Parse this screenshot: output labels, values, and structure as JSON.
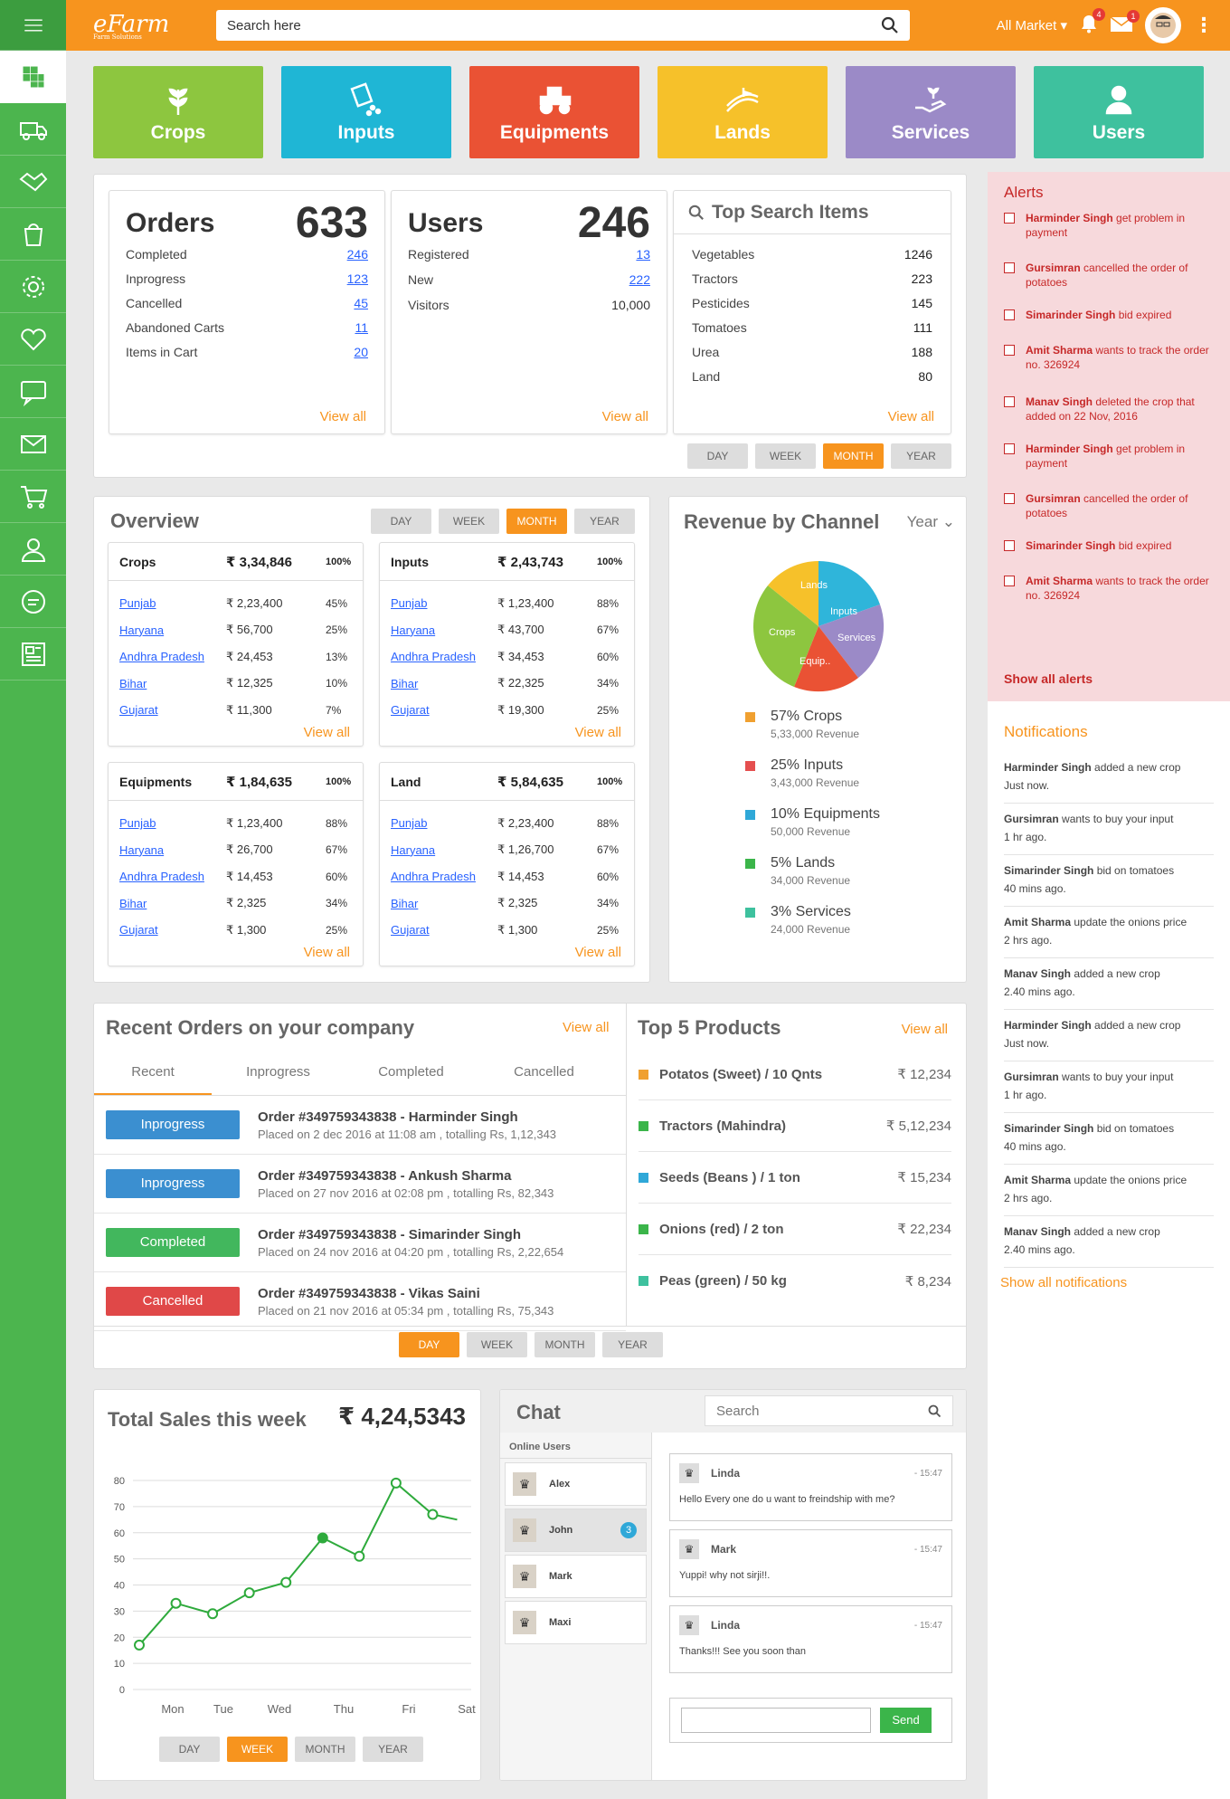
{
  "topbar": {
    "logo": "eFarm",
    "logo_sub": "Farm Solutions",
    "search_placeholder": "Search here",
    "market": "All Market",
    "notif_count": "4",
    "mail_count": "1"
  },
  "sidebar": {
    "items": [
      "dashboard-icon",
      "truck-icon",
      "handshake-icon",
      "shopping-bag-icon",
      "gear-icon",
      "heart-icon",
      "sms-icon",
      "mail-icon",
      "cart-icon",
      "user-icon",
      "chat-icon",
      "news-icon"
    ]
  },
  "tiles": [
    {
      "label": "Crops",
      "color": "#8dc63f",
      "icon": "crop-icon"
    },
    {
      "label": "Inputs",
      "color": "#1fb6d5",
      "icon": "inputs-icon"
    },
    {
      "label": "Equipments",
      "color": "#ea5234",
      "icon": "tractor-icon"
    },
    {
      "label": "Lands",
      "color": "#f6c12a",
      "icon": "land-icon"
    },
    {
      "label": "Services",
      "color": "#9b8ac7",
      "icon": "services-icon"
    },
    {
      "label": "Users",
      "color": "#3ec19e",
      "icon": "users-icon"
    }
  ],
  "orders": {
    "title": "Orders",
    "total": "633",
    "rows": [
      {
        "label": "Completed",
        "value": "246"
      },
      {
        "label": "Inprogress",
        "value": "123"
      },
      {
        "label": "Cancelled",
        "value": "45"
      },
      {
        "label": "Abandoned Carts",
        "value": "11"
      },
      {
        "label": "Items in Cart",
        "value": "20"
      }
    ],
    "view_all": "View all"
  },
  "users": {
    "title": "Users",
    "total": "246",
    "rows": [
      {
        "label": "Registered",
        "value": "13",
        "link": true
      },
      {
        "label": "New",
        "value": "222",
        "link": true
      },
      {
        "label": "Visitors",
        "value": "10,000",
        "link": false
      }
    ],
    "view_all": "View all"
  },
  "top_search": {
    "title": "Top Search Items",
    "rows": [
      {
        "label": "Vegetables",
        "value": "1246"
      },
      {
        "label": "Tractors",
        "value": "223"
      },
      {
        "label": "Pesticides",
        "value": "145"
      },
      {
        "label": "Tomatoes",
        "value": "111"
      },
      {
        "label": "Urea",
        "value": "188"
      },
      {
        "label": "Land",
        "value": "80"
      }
    ],
    "view_all": "View all"
  },
  "period": {
    "day": "DAY",
    "week": "WEEK",
    "month": "MONTH",
    "year": "YEAR"
  },
  "overview": {
    "title": "Overview",
    "blocks": [
      {
        "name": "Crops",
        "total": "₹ 3,34,846",
        "pct": "100%",
        "rows": [
          [
            "Punjab",
            "₹ 2,23,400",
            "45%"
          ],
          [
            "Haryana",
            "₹ 56,700",
            "25%"
          ],
          [
            "Andhra Pradesh",
            "₹ 24,453",
            "13%"
          ],
          [
            "Bihar",
            "₹ 12,325",
            "10%"
          ],
          [
            "Gujarat",
            "₹ 11,300",
            "7%"
          ]
        ]
      },
      {
        "name": "Inputs",
        "total": "₹ 2,43,743",
        "pct": "100%",
        "rows": [
          [
            "Punjab",
            "₹ 1,23,400",
            "88%"
          ],
          [
            "Haryana",
            "₹ 43,700",
            "67%"
          ],
          [
            "Andhra Pradesh",
            "₹ 34,453",
            "60%"
          ],
          [
            "Bihar",
            "₹ 22,325",
            "34%"
          ],
          [
            "Gujarat",
            "₹ 19,300",
            "25%"
          ]
        ]
      },
      {
        "name": "Equipments",
        "total": "₹ 1,84,635",
        "pct": "100%",
        "rows": [
          [
            "Punjab",
            "₹ 1,23,400",
            "88%"
          ],
          [
            "Haryana",
            "₹ 26,700",
            "67%"
          ],
          [
            "Andhra Pradesh",
            "₹ 14,453",
            "60%"
          ],
          [
            "Bihar",
            "₹ 2,325",
            "34%"
          ],
          [
            "Gujarat",
            "₹ 1,300",
            "25%"
          ]
        ]
      },
      {
        "name": "Land",
        "total": "₹ 5,84,635",
        "pct": "100%",
        "rows": [
          [
            "Punjab",
            "₹ 2,23,400",
            "88%"
          ],
          [
            "Haryana",
            "₹ 1,26,700",
            "67%"
          ],
          [
            "Andhra Pradesh",
            "₹ 14,453",
            "60%"
          ],
          [
            "Bihar",
            "₹ 2,325",
            "34%"
          ],
          [
            "Gujarat",
            "₹ 1,300",
            "25%"
          ]
        ]
      }
    ],
    "view_all": "View all"
  },
  "revenue": {
    "title": "Revenue by Channel",
    "period": "Year",
    "legend": [
      {
        "pct": "57%",
        "name": "Crops",
        "sub": "5,33,000 Revenue",
        "color": "#f0a030"
      },
      {
        "pct": "25%",
        "name": "Inputs",
        "sub": "3,43,000 Revenue",
        "color": "#e54f4f"
      },
      {
        "pct": "10%",
        "name": "Equipments",
        "sub": "50,000 Revenue",
        "color": "#2fa8d8"
      },
      {
        "pct": "5%",
        "name": "Lands",
        "sub": "34,000 Revenue",
        "color": "#3bb54a"
      },
      {
        "pct": "3%",
        "name": "Services",
        "sub": "24,000 Revenue",
        "color": "#3ec19e"
      }
    ]
  },
  "recent_orders": {
    "title": "Recent Orders on your company",
    "view_all": "View all",
    "tabs": [
      "Recent",
      "Inprogress",
      "Completed",
      "Cancelled"
    ],
    "rows": [
      {
        "status": "Inprogress",
        "color": "#3b8fd0",
        "title": "Order #349759343838  - Harminder Singh",
        "sub": "Placed on 2 dec 2016 at 11:08 am , totalling Rs, 1,12,343"
      },
      {
        "status": "Inprogress",
        "color": "#3b8fd0",
        "title": "Order #349759343838  - Ankush Sharma",
        "sub": "Placed on 27 nov 2016 at 02:08 pm , totalling Rs, 82,343"
      },
      {
        "status": "Completed",
        "color": "#42b75d",
        "title": "Order #349759343838  - Simarinder Singh",
        "sub": "Placed on 24 nov 2016 at 04:20 pm , totalling Rs, 2,22,654"
      },
      {
        "status": "Cancelled",
        "color": "#e04848",
        "title": "Order #349759343838  - Vikas Saini",
        "sub": "Placed on 21 nov 2016 at 05:34 pm , totalling Rs, 75,343"
      }
    ]
  },
  "top_products": {
    "title": "Top 5 Products",
    "view_all": "View all",
    "rows": [
      {
        "name": "Potatos (Sweet) / 10 Qnts",
        "price": "₹ 12,234",
        "color": "#f0a030"
      },
      {
        "name": "Tractors (Mahindra)",
        "price": "₹ 5,12,234",
        "color": "#3bb54a"
      },
      {
        "name": "Seeds (Beans ) / 1 ton",
        "price": "₹ 15,234",
        "color": "#2fa8d8"
      },
      {
        "name": "Onions (red) / 2 ton",
        "price": "₹ 22,234",
        "color": "#3bb54a"
      },
      {
        "name": "Peas (green) / 50 kg",
        "price": "₹ 8,234",
        "color": "#3ec19e"
      }
    ]
  },
  "sales": {
    "title": "Total Sales this week",
    "total": "₹ 4,24,5343"
  },
  "chart_data": {
    "type": "line",
    "x": [
      "Mon",
      "Tue",
      "Wed",
      "Thu",
      "Fri",
      "Sat"
    ],
    "points": [
      [
        0,
        17
      ],
      [
        0.6,
        33
      ],
      [
        1.2,
        29
      ],
      [
        1.8,
        37
      ],
      [
        2.4,
        41
      ],
      [
        3.0,
        58
      ],
      [
        3.6,
        51
      ],
      [
        4.2,
        79
      ],
      [
        4.8,
        67
      ],
      [
        5.2,
        65
      ]
    ],
    "yticks": [
      0,
      10,
      20,
      30,
      40,
      50,
      60,
      70,
      80
    ],
    "ylim": [
      0,
      80
    ],
    "color": "#2eaa3c"
  },
  "chat": {
    "title": "Chat",
    "search_placeholder": "Search",
    "online_label": "Online Users",
    "users": [
      {
        "name": "Alex",
        "badge": ""
      },
      {
        "name": "John",
        "badge": "3"
      },
      {
        "name": "Mark",
        "badge": ""
      },
      {
        "name": "Maxi",
        "badge": ""
      }
    ],
    "messages": [
      {
        "name": "Linda",
        "time": "- 15:47",
        "text": "Hello Every one do u want to freindship with me?"
      },
      {
        "name": "Mark",
        "time": "- 15:47",
        "text": "Yuppi! why not sirji!!."
      },
      {
        "name": "Linda",
        "time": "- 15:47",
        "text": "Thanks!!! See you soon than"
      }
    ],
    "send": "Send"
  },
  "alerts": {
    "title": "Alerts",
    "items": [
      {
        "who": "Harminder Singh",
        "what": " get problem in payment"
      },
      {
        "who": "Gursimran",
        "what": " cancelled the order of potatoes"
      },
      {
        "who": "Simarinder Singh",
        "what": " bid expired"
      },
      {
        "who": "Amit Sharma",
        "what": " wants to  track the order no. 326924"
      },
      {
        "who": "Manav Singh",
        "what": " deleted the crop that added on 22 Nov, 2016"
      },
      {
        "who": "Harminder Singh",
        "what": " get problem in payment"
      },
      {
        "who": "Gursimran",
        "what": " cancelled the order of potatoes"
      },
      {
        "who": "Simarinder Singh",
        "what": " bid expired"
      },
      {
        "who": "Amit Sharma",
        "what": " wants to  track the order no. 326924"
      }
    ],
    "show_all": "Show  all alerts"
  },
  "notifications": {
    "title": "Notifications",
    "items": [
      {
        "who": "Harminder Singh",
        "what": " added a new crop",
        "time": "Just now."
      },
      {
        "who": "Gursimran",
        "what": " wants to buy your input",
        "time": "1 hr ago."
      },
      {
        "who": "Simarinder Singh",
        "what": " bid on tomatoes",
        "time": "40 mins ago."
      },
      {
        "who": "Amit Sharma",
        "what": " update the onions price",
        "time": "2 hrs ago."
      },
      {
        "who": "Manav Singh",
        "what": " added a new crop",
        "time": "2.40 mins ago."
      },
      {
        "who": "Harminder Singh",
        "what": " added a new crop",
        "time": "Just now."
      },
      {
        "who": "Gursimran",
        "what": " wants to buy your input",
        "time": "1 hr ago."
      },
      {
        "who": "Simarinder Singh",
        "what": " bid on tomatoes",
        "time": "40 mins ago."
      },
      {
        "who": "Amit Sharma",
        "what": " update the onions price",
        "time": "2 hrs ago."
      },
      {
        "who": "Manav Singh",
        "what": " added a new crop",
        "time": "2.40 mins ago."
      }
    ],
    "show_all": "Show  all notifications"
  }
}
